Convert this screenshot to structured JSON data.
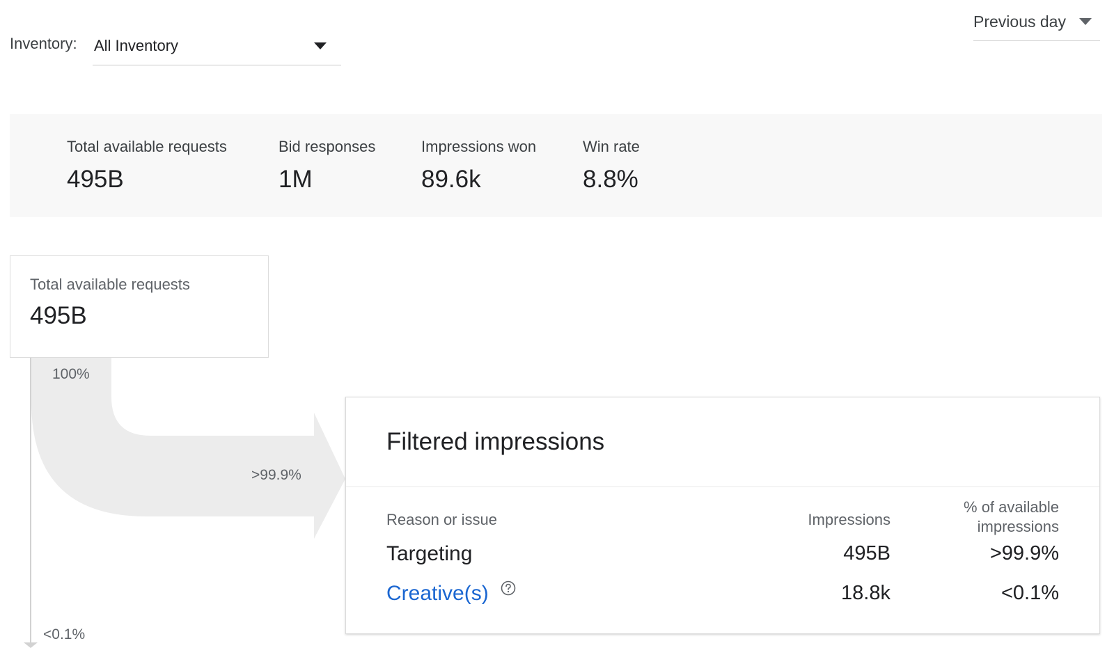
{
  "header": {
    "date_range": {
      "label": "Previous day"
    },
    "inventory": {
      "label": "Inventory:",
      "value": "All Inventory"
    }
  },
  "summary": {
    "metrics": [
      {
        "label": "Total available requests",
        "value": "495B"
      },
      {
        "label": "Bid responses",
        "value": "1M"
      },
      {
        "label": "Impressions won",
        "value": "89.6k"
      },
      {
        "label": "Win rate",
        "value": "8.8%"
      }
    ]
  },
  "funnel": {
    "source": {
      "label": "Total available requests",
      "value": "495B"
    },
    "split_percent": "100%",
    "filtered_percent": ">99.9%",
    "passed_percent": "<0.1%"
  },
  "filtered_card": {
    "title": "Filtered impressions",
    "columns": {
      "reason": "Reason or issue",
      "impressions": "Impressions",
      "percent_line1": "% of available",
      "percent_line2": "impressions"
    },
    "rows": [
      {
        "reason": "Targeting",
        "impressions": "495B",
        "percent": ">99.9%"
      },
      {
        "reason": "Creative(s)",
        "impressions": "18.8k",
        "percent": "<0.1%"
      }
    ]
  },
  "colors": {
    "link": "#1a66d1",
    "flow": "#ececec",
    "summary_bg": "#f8f8f8"
  },
  "icons": {
    "dropdown": "caret-down-icon",
    "help": "help-circle-icon"
  }
}
